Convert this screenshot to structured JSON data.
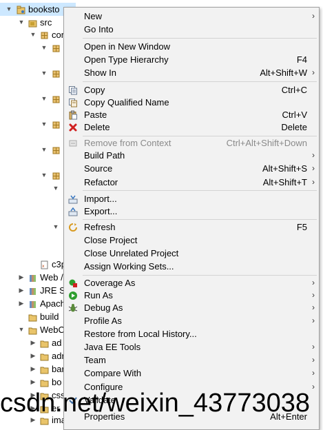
{
  "tree": {
    "root": "booksto",
    "src": "src",
    "con": "con",
    "c3p": "c3p",
    "web": "Web /",
    "jre": "JRE Sy",
    "apache": "Apach",
    "build": "build",
    "webcontent": "WebC",
    "ad": "ad",
    "adr": "adr",
    "bar": "bar",
    "bo": "bo",
    "css": "css",
    "er": "er",
    "ima": "ima"
  },
  "menu": {
    "items": [
      {
        "label": "New",
        "shortcut": "",
        "submenu": true,
        "disabled": false,
        "icon": ""
      },
      {
        "label": "Go Into",
        "shortcut": "",
        "submenu": false,
        "disabled": false,
        "icon": ""
      },
      {
        "label": "Open in New Window",
        "shortcut": "",
        "submenu": false,
        "disabled": false,
        "icon": ""
      },
      {
        "label": "Open Type Hierarchy",
        "shortcut": "F4",
        "submenu": false,
        "disabled": false,
        "icon": ""
      },
      {
        "label": "Show In",
        "shortcut": "Alt+Shift+W",
        "submenu": true,
        "disabled": false,
        "icon": ""
      },
      {
        "label": "Copy",
        "shortcut": "Ctrl+C",
        "submenu": false,
        "disabled": false,
        "icon": "copy-icon"
      },
      {
        "label": "Copy Qualified Name",
        "shortcut": "",
        "submenu": false,
        "disabled": false,
        "icon": "copy-qualified-icon"
      },
      {
        "label": "Paste",
        "shortcut": "Ctrl+V",
        "submenu": false,
        "disabled": false,
        "icon": "paste-icon"
      },
      {
        "label": "Delete",
        "shortcut": "Delete",
        "submenu": false,
        "disabled": false,
        "icon": "delete-icon"
      },
      {
        "label": "Remove from Context",
        "shortcut": "Ctrl+Alt+Shift+Down",
        "submenu": false,
        "disabled": true,
        "icon": "remove-context-icon"
      },
      {
        "label": "Build Path",
        "shortcut": "",
        "submenu": true,
        "disabled": false,
        "icon": ""
      },
      {
        "label": "Source",
        "shortcut": "Alt+Shift+S",
        "submenu": true,
        "disabled": false,
        "icon": ""
      },
      {
        "label": "Refactor",
        "shortcut": "Alt+Shift+T",
        "submenu": true,
        "disabled": false,
        "icon": ""
      },
      {
        "label": "Import...",
        "shortcut": "",
        "submenu": false,
        "disabled": false,
        "icon": "import-icon"
      },
      {
        "label": "Export...",
        "shortcut": "",
        "submenu": false,
        "disabled": false,
        "icon": "export-icon"
      },
      {
        "label": "Refresh",
        "shortcut": "F5",
        "submenu": false,
        "disabled": false,
        "icon": "refresh-icon"
      },
      {
        "label": "Close Project",
        "shortcut": "",
        "submenu": false,
        "disabled": false,
        "icon": ""
      },
      {
        "label": "Close Unrelated Project",
        "shortcut": "",
        "submenu": false,
        "disabled": false,
        "icon": ""
      },
      {
        "label": "Assign Working Sets...",
        "shortcut": "",
        "submenu": false,
        "disabled": false,
        "icon": ""
      },
      {
        "label": "Coverage As",
        "shortcut": "",
        "submenu": true,
        "disabled": false,
        "icon": "coverage-icon"
      },
      {
        "label": "Run As",
        "shortcut": "",
        "submenu": true,
        "disabled": false,
        "icon": "run-icon"
      },
      {
        "label": "Debug As",
        "shortcut": "",
        "submenu": true,
        "disabled": false,
        "icon": "debug-icon"
      },
      {
        "label": "Profile As",
        "shortcut": "",
        "submenu": true,
        "disabled": false,
        "icon": ""
      },
      {
        "label": "Restore from Local History...",
        "shortcut": "",
        "submenu": false,
        "disabled": false,
        "icon": ""
      },
      {
        "label": "Java EE Tools",
        "shortcut": "",
        "submenu": true,
        "disabled": false,
        "icon": ""
      },
      {
        "label": "Team",
        "shortcut": "",
        "submenu": true,
        "disabled": false,
        "icon": ""
      },
      {
        "label": "Compare With",
        "shortcut": "",
        "submenu": true,
        "disabled": false,
        "icon": ""
      },
      {
        "label": "Configure",
        "shortcut": "",
        "submenu": true,
        "disabled": false,
        "icon": ""
      },
      {
        "label": "Validate",
        "shortcut": "",
        "submenu": false,
        "disabled": false,
        "icon": "validate-check-icon"
      },
      {
        "label": "Properties",
        "shortcut": "Alt+Enter",
        "submenu": false,
        "disabled": false,
        "icon": ""
      }
    ],
    "submenu_arrow": "›"
  },
  "watermark": "csdn.net/weixin_43773038",
  "colors": {
    "menu_bg": "#f2f2f2",
    "selection": "#cde8ff",
    "disabled_text": "#8a8a8a",
    "package_icon": "#c8a032",
    "delete_red": "#d02020",
    "run_green": "#2e9e2e"
  }
}
